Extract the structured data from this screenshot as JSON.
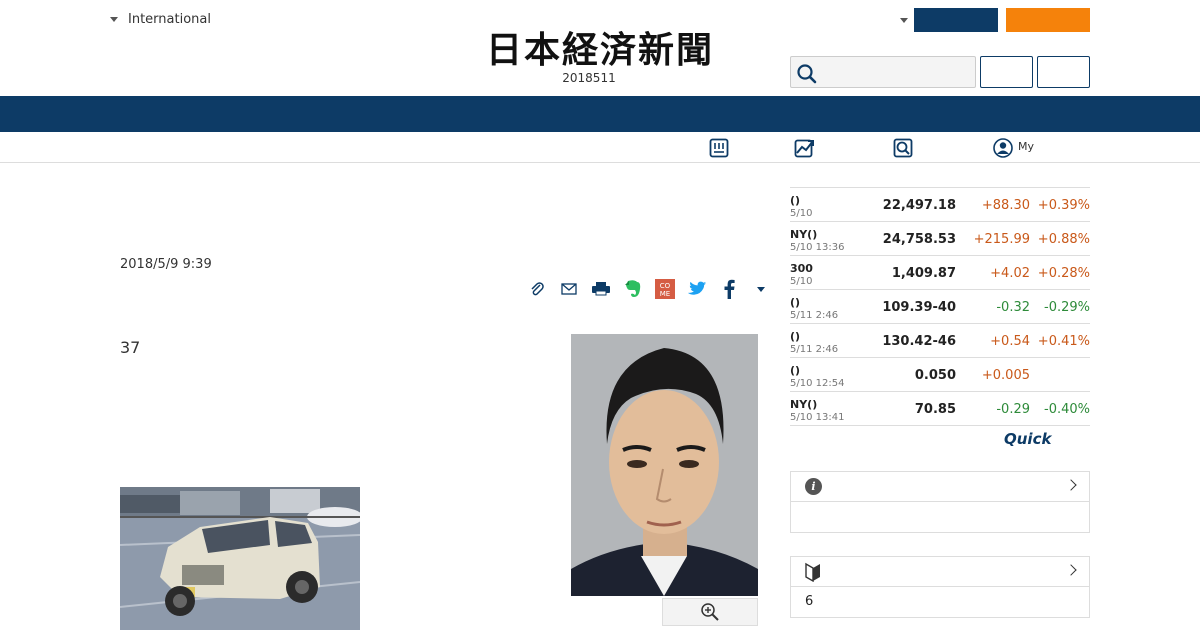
{
  "header": {
    "region_label": "International",
    "logo_text": "日本経済新聞",
    "issue_date": "2018511"
  },
  "subnav": {
    "my_label": "My"
  },
  "article": {
    "published": "2018/5/9 9:39",
    "lead_text": "37"
  },
  "market": {
    "rows": [
      {
        "name": "()",
        "time": "5/10",
        "value": "22,497.18",
        "change": "+88.30",
        "pct": "+0.39%",
        "dir": "up"
      },
      {
        "name": "NY()",
        "time": "5/10 13:36",
        "value": "24,758.53",
        "change": "+215.99",
        "pct": "+0.88%",
        "dir": "up"
      },
      {
        "name": "300",
        "time": "5/10",
        "value": "1,409.87",
        "change": "+4.02",
        "pct": "+0.28%",
        "dir": "up"
      },
      {
        "name": "()",
        "time": "5/11 2:46",
        "value": "109.39-40",
        "change": "-0.32",
        "pct": "-0.29%",
        "dir": "down"
      },
      {
        "name": "()",
        "time": "5/11 2:46",
        "value": "130.42-46",
        "change": "+0.54",
        "pct": "+0.41%",
        "dir": "up"
      },
      {
        "name": "()",
        "time": "5/10 12:54",
        "value": "0.050",
        "change": "+0.005",
        "pct": "",
        "dir": "up"
      },
      {
        "name": "NY()",
        "time": "5/10 13:41",
        "value": "70.85",
        "change": "-0.29",
        "pct": "-0.40%",
        "dir": "down"
      }
    ],
    "provider": "Quick"
  },
  "sidebox2": {
    "count_text": "6"
  },
  "icons": {
    "search": "search-icon",
    "chevron": "chevron-right-icon",
    "info": "info-icon",
    "beginner": "beginner-mark-icon"
  },
  "colors": {
    "navy": "#0d3b66",
    "orange": "#f5820b",
    "up": "#c9591a",
    "down": "#2e8b3a"
  }
}
